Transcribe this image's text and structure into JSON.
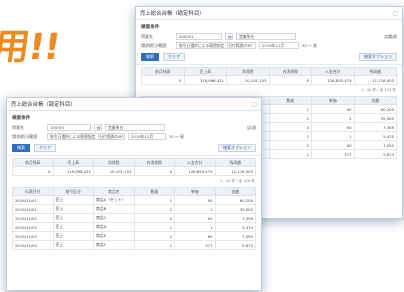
{
  "headline": "用!!",
  "back": {
    "title": "売上総合台帳（勘定科目）",
    "section": "検索条件",
    "row1": {
      "label": "得意先",
      "code": "000001",
      "name": "営業所名",
      "right": "店舗/部"
    },
    "row2": {
      "label": "請求締日/範囲",
      "value": "取引日選択による範囲指定（日付範囲のみ）",
      "date": "2019年11月",
      "count": "30 〜 現"
    },
    "search_btn": "検索",
    "clear_btn": "クリア",
    "option_btn": "検索オプション",
    "summary_headers": [
      "前月残高",
      "売上高",
      "消費税",
      "内消費税",
      "入金合計",
      "残高額"
    ],
    "summary_values": [
      "0",
      "119,998,421",
      "10,101,153",
      "0",
      "126,853,479",
      "11,116,003"
    ],
    "pager": "1 - 10 件 / 全 120 件",
    "detail_headers": [
      "売上日",
      "",
      "商品名",
      "数量",
      "単価",
      "金額"
    ],
    "detail_rows": [
      [
        "2019/11/01",
        "売上",
        "商品A",
        "1",
        "90",
        "60,200"
      ],
      [
        "2019/11/01",
        "売上",
        "商品B",
        "2",
        "1",
        "35,000"
      ],
      [
        "2019/11/02",
        "売上",
        "商品C",
        "3",
        "90",
        "7,309"
      ],
      [
        "2019/11/02",
        "売上",
        "商品D",
        "1",
        "1",
        "5,470"
      ],
      [
        "2019/11/03",
        "売上",
        "商品E",
        "2",
        "60",
        "7,050"
      ],
      [
        "2019/11/03",
        "売上",
        "商品F",
        "1",
        "377",
        "5,673"
      ]
    ]
  },
  "front": {
    "title": "売上総合台帳（勘定科目）",
    "section": "検索条件",
    "row1": {
      "label": "得意先",
      "code": "100001",
      "name": "営業所名",
      "right": "店/部"
    },
    "row2": {
      "label": "請求締日/範囲",
      "value": "取引日選択による範囲指定（日付範囲のみ）",
      "date": "2019年11月",
      "count": "30 〜 現"
    },
    "search_btn": "検索",
    "clear_btn": "クリア",
    "option_btn": "検索オプション",
    "summary_headers": [
      "前月残高",
      "売上高",
      "消費税",
      "内消費税",
      "入金合計",
      "残高額"
    ],
    "summary_values": [
      "0",
      "119,998,421",
      "10,101,153",
      "0",
      "126,853,479",
      "11,116,003"
    ],
    "pager": "1 - 10 件 / 全 120 件",
    "detail_headers": [
      "伝票日付",
      "取引区分",
      "商品名",
      "数量",
      "単価",
      "金額"
    ],
    "detail_rows": [
      [
        "2019/11/01",
        "売上",
        "商品A（セット）",
        "1",
        "90",
        "60,200"
      ],
      [
        "2019/11/01",
        "売上",
        "商品B",
        "2",
        "1",
        "35,000"
      ],
      [
        "2019/11/02",
        "売上",
        "商品C",
        "3",
        "90",
        "7,309"
      ],
      [
        "2019/11/02",
        "売上",
        "商品D",
        "1",
        "1",
        "5,470"
      ],
      [
        "2019/11/03",
        "売上",
        "商品E",
        "2",
        "60",
        "7,050"
      ],
      [
        "2019/11/03",
        "売上",
        "商品F",
        "1",
        "377",
        "5,673"
      ]
    ]
  }
}
